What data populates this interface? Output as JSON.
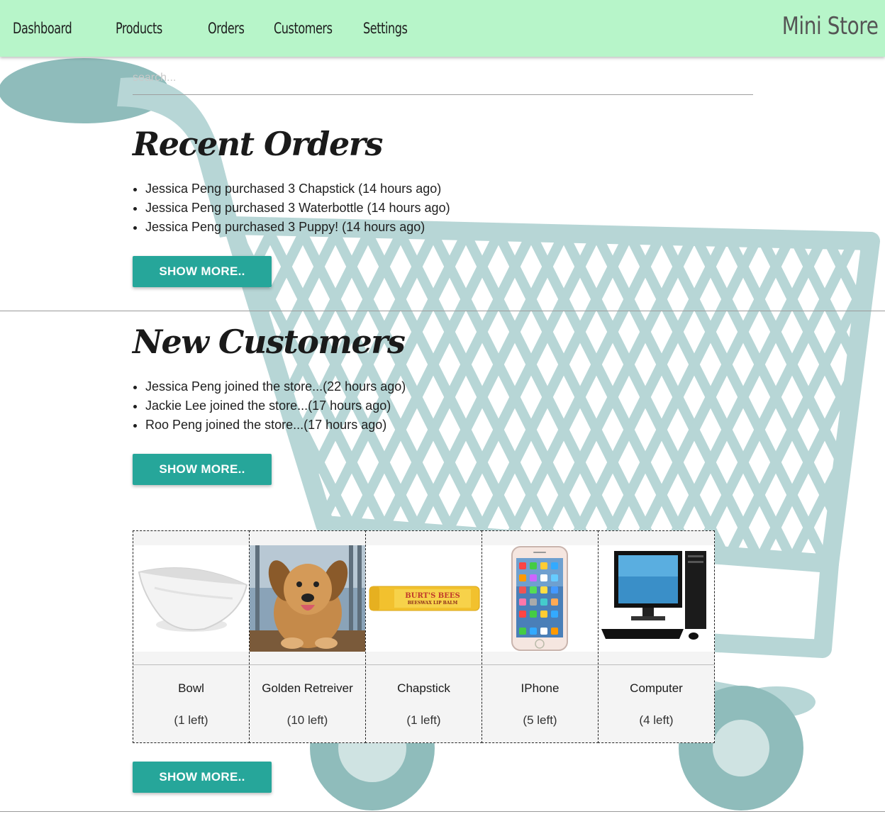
{
  "nav": {
    "links": [
      "Dashboard",
      "Products",
      "Orders",
      "Customers",
      "Settings"
    ],
    "brand": "Mini Store"
  },
  "search": {
    "placeholder": "search..."
  },
  "recent_orders": {
    "title": "Recent Orders",
    "items": [
      "Jessica Peng purchased 3 Chapstick (14 hours ago)",
      "Jessica Peng purchased 3 Waterbottle (14 hours ago)",
      "Jessica Peng purchased 3 Puppy! (14 hours ago)"
    ],
    "button": "SHOW MORE.."
  },
  "new_customers": {
    "title": "New Customers",
    "items": [
      "Jessica Peng joined the store...(22 hours ago)",
      "Jackie Lee joined the store...(17 hours ago)",
      "Roo Peng joined the store...(17 hours ago)"
    ],
    "button": "SHOW MORE.."
  },
  "products": {
    "items": [
      {
        "name": "Bowl",
        "stock": "(1 left)",
        "image": "bowl-image"
      },
      {
        "name": "Golden Retreiver",
        "stock": "(10 left)",
        "image": "puppy-image"
      },
      {
        "name": "Chapstick",
        "stock": "(1 left)",
        "image": "chapstick-image"
      },
      {
        "name": "IPhone",
        "stock": "(5 left)",
        "image": "iphone-image"
      },
      {
        "name": "Computer",
        "stock": "(4 left)",
        "image": "computer-image"
      }
    ],
    "chapstick_label": "BURT'S BEES",
    "chapstick_sublabel": "BEESWAX LIP BALM",
    "button": "SHOW MORE.."
  },
  "colors": {
    "navbar": "#b7f5c9",
    "accent": "#26a69a",
    "cart": "#b7d6d6"
  }
}
